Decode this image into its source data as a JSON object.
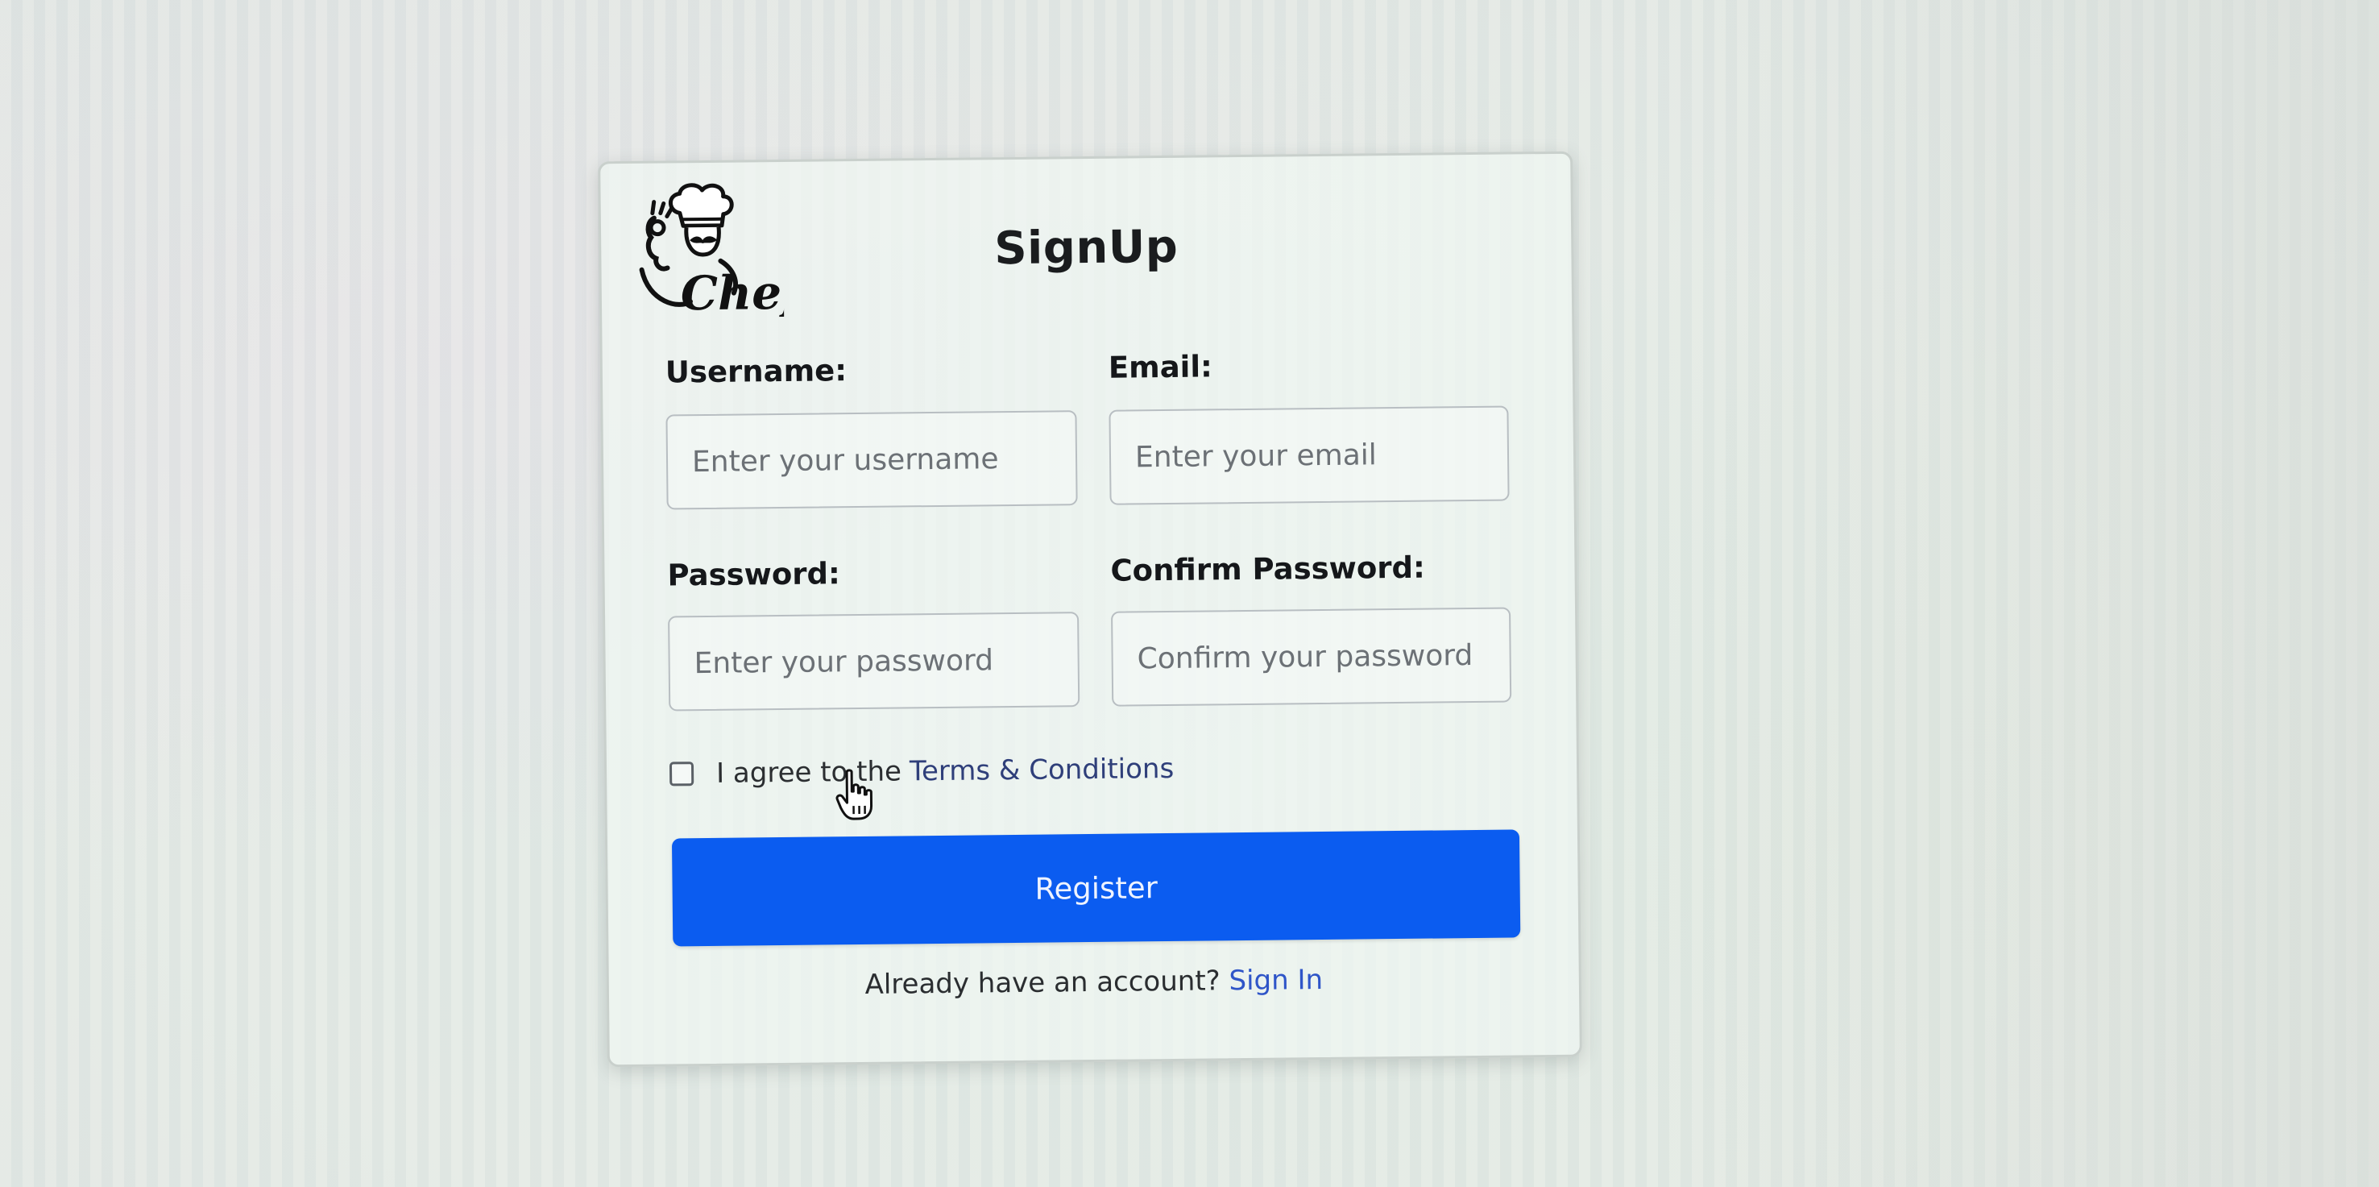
{
  "form": {
    "logo_alt": "Chef",
    "title": "SignUp",
    "username": {
      "label": "Username:",
      "placeholder": "Enter your username",
      "value": ""
    },
    "email": {
      "label": "Email:",
      "placeholder": "Enter your email",
      "value": ""
    },
    "password": {
      "label": "Password:",
      "placeholder": "Enter your password",
      "value": ""
    },
    "confirm_password": {
      "label": "Confirm Password:",
      "placeholder": "Confirm your password",
      "value": ""
    },
    "terms": {
      "checked": false,
      "text": "I agree to the",
      "link_text": "Terms & Conditions"
    },
    "register_label": "Register",
    "footer": {
      "text": "Already have an account?",
      "link_text": "Sign In"
    }
  },
  "colors": {
    "primary_button": "#0b5cf0",
    "link": "#2f55c8"
  },
  "icons": {
    "logo": "chef-logo-icon",
    "cursor": "hand-pointer-icon"
  }
}
